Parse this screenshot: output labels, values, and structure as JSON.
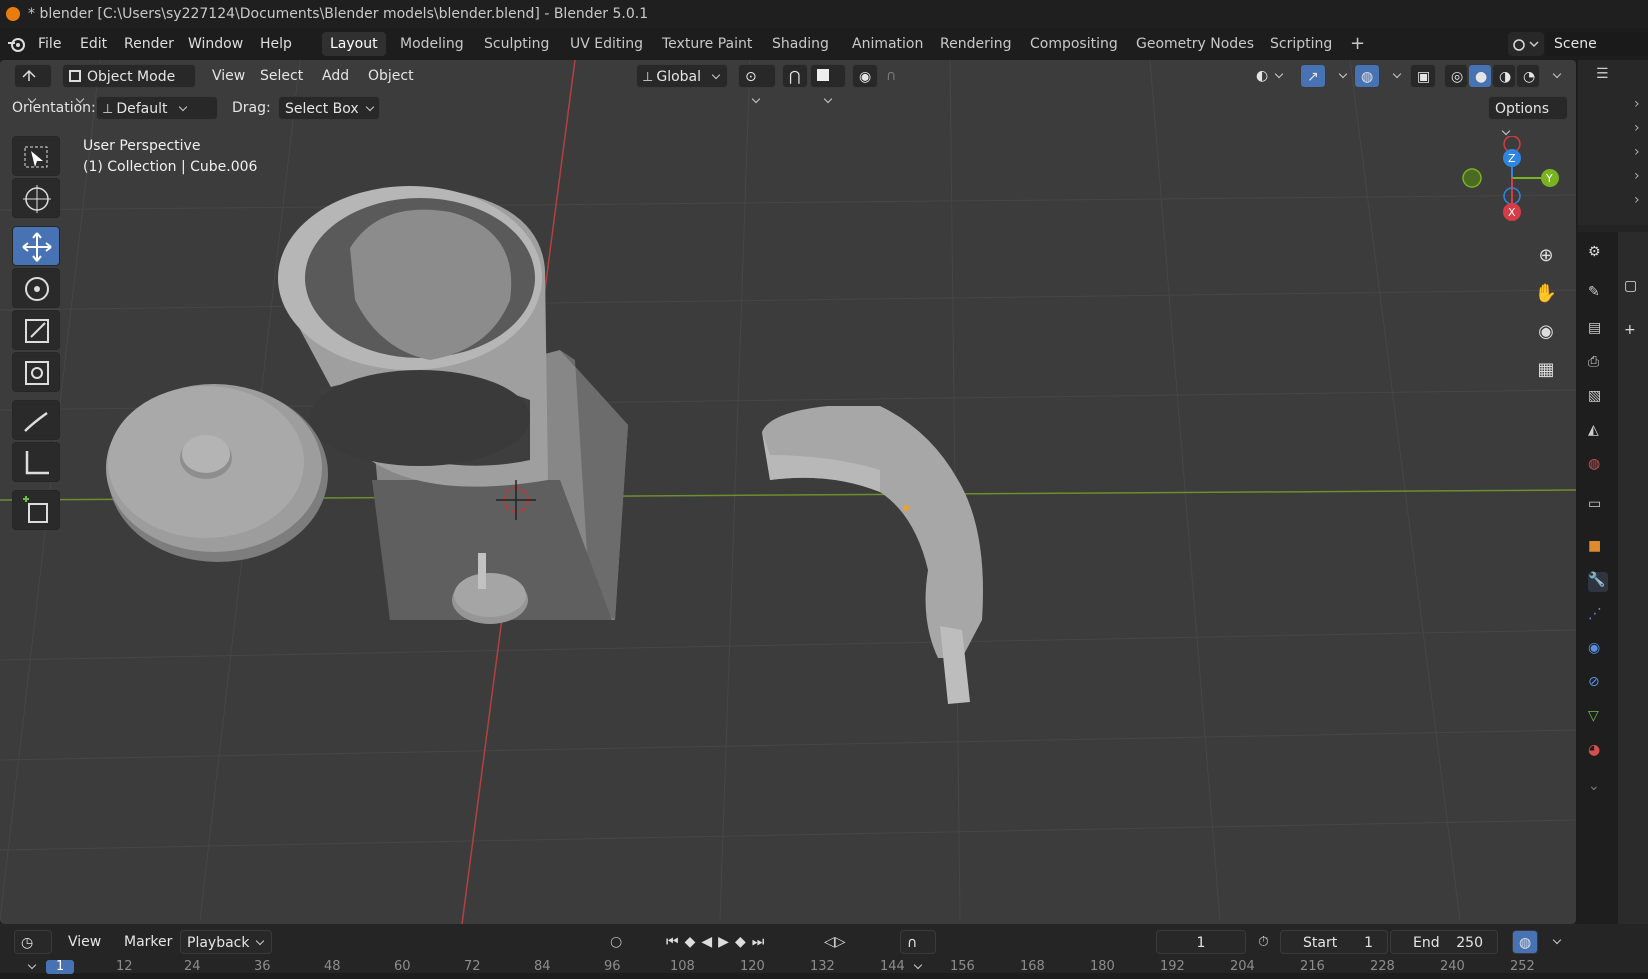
{
  "titlebar": {
    "title": "* blender [C:\\Users\\sy227124\\Documents\\Blender models\\blender.blend] - Blender 5.0.1"
  },
  "menu": {
    "items": [
      "File",
      "Edit",
      "Render",
      "Window",
      "Help"
    ]
  },
  "workspaces": {
    "tabs": [
      "Layout",
      "Modeling",
      "Sculpting",
      "UV Editing",
      "Texture Paint",
      "Shading",
      "Animation",
      "Rendering",
      "Compositing",
      "Geometry Nodes",
      "Scripting"
    ],
    "active": "Layout",
    "add_label": "+"
  },
  "scene": {
    "name": "Scene"
  },
  "viewport_header": {
    "mode": "Object Mode",
    "view": "View",
    "select": "Select",
    "add": "Add",
    "object": "Object",
    "transform_orientation": "Global"
  },
  "tool_settings": {
    "orientation_label": "Orientation:",
    "orientation_value": "Default",
    "drag_label": "Drag:",
    "drag_value": "Select Box",
    "options": "Options"
  },
  "viewport_overlay": {
    "perspective": "User Perspective",
    "collection": "(1) Collection | Cube.006"
  },
  "gizmo": {
    "x": "X",
    "y": "Y",
    "z": "Z"
  },
  "timeline": {
    "view": "View",
    "marker": "Marker",
    "playback": "Playback",
    "current_frame": "1",
    "start_label": "Start",
    "start_value": "1",
    "end_label": "End",
    "end_value": "250",
    "ruler": [
      "1",
      "12",
      "24",
      "36",
      "48",
      "60",
      "72",
      "84",
      "96",
      "108",
      "120",
      "132",
      "144",
      "156",
      "168",
      "180",
      "192",
      "204",
      "216",
      "228",
      "240",
      "252"
    ]
  },
  "colors": {
    "accent": "#4772b3",
    "x_axis": "#d63c46",
    "y_axis": "#78b320",
    "z_axis": "#2e86e0",
    "viewport_bg": "#3c3c3c"
  }
}
